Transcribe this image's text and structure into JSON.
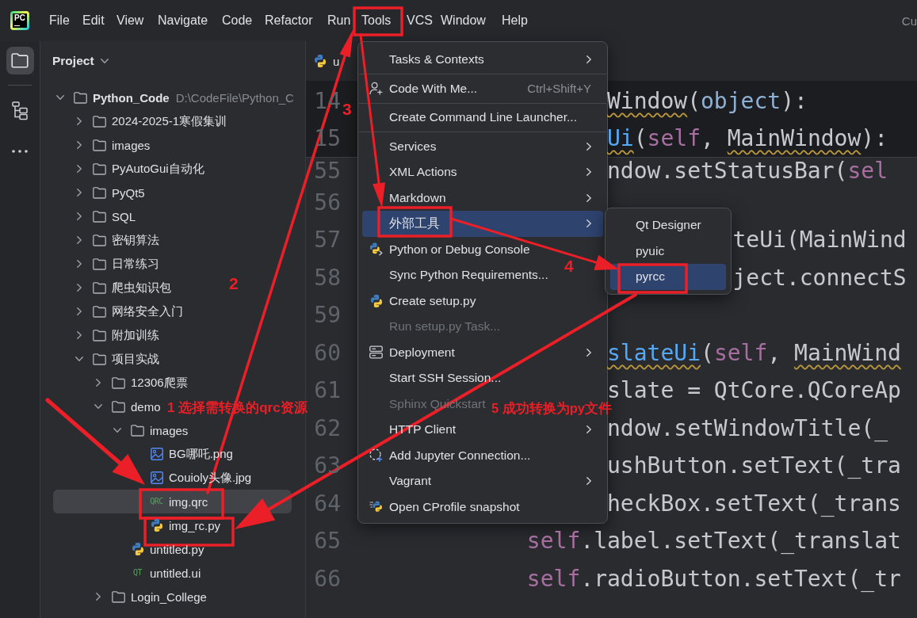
{
  "menu_bar": {
    "logo_text": "PC",
    "items": [
      "File",
      "Edit",
      "View",
      "Navigate",
      "Code",
      "Refactor",
      "Run",
      "Tools",
      "VCS",
      "Window",
      "Help"
    ],
    "right_text": "Cu"
  },
  "tool_strip": {
    "buttons": [
      {
        "selected": true
      },
      {
        "selected": false
      },
      {
        "selected": false
      }
    ]
  },
  "project_panel": {
    "title": "Project",
    "tree": [
      {
        "label": "Python_Code",
        "hint": "D:\\CodeFile\\Python_C",
        "kind": "folder",
        "expanded": true,
        "selected": false,
        "children": [
          {
            "label": "2024-2025-1寒假集训",
            "kind": "folder",
            "expanded": false,
            "selected": false
          },
          {
            "label": "images",
            "kind": "folder",
            "expanded": false,
            "selected": false
          },
          {
            "label": "PyAutoGui自动化",
            "kind": "folder",
            "expanded": false,
            "selected": false
          },
          {
            "label": "PyQt5",
            "kind": "folder",
            "expanded": false,
            "selected": false
          },
          {
            "label": "SQL",
            "kind": "folder",
            "expanded": false,
            "selected": false
          },
          {
            "label": "密钥算法",
            "kind": "folder",
            "expanded": false,
            "selected": false
          },
          {
            "label": "日常练习",
            "kind": "folder",
            "expanded": false,
            "selected": false
          },
          {
            "label": "爬虫知识包",
            "kind": "folder",
            "expanded": false,
            "selected": false
          },
          {
            "label": "网络安全入门",
            "kind": "folder",
            "expanded": false,
            "selected": false
          },
          {
            "label": "附加训练",
            "kind": "folder",
            "expanded": false,
            "selected": false
          },
          {
            "label": "项目实战",
            "kind": "folder",
            "expanded": true,
            "selected": false,
            "children": [
              {
                "label": "12306爬票",
                "kind": "folder",
                "expanded": false,
                "selected": false
              },
              {
                "label": "demo",
                "kind": "folder",
                "expanded": true,
                "selected": false,
                "children": [
                  {
                    "label": "images",
                    "kind": "folder",
                    "expanded": true,
                    "selected": false,
                    "children": [
                      {
                        "label": "BG哪吒.png",
                        "kind": "image",
                        "selected": false
                      },
                      {
                        "label": "Couioly头像.jpg",
                        "kind": "image",
                        "selected": false
                      },
                      {
                        "label": "img.qrc",
                        "kind": "qrc",
                        "badge": "QRC",
                        "selected": true
                      },
                      {
                        "label": "img_rc.py",
                        "kind": "python",
                        "selected": false
                      }
                    ]
                  },
                  {
                    "label": "untitled.py",
                    "kind": "python",
                    "selected": false
                  },
                  {
                    "label": "untitled.ui",
                    "kind": "ui",
                    "badge": "QT",
                    "selected": false
                  }
                ]
              },
              {
                "label": "Login_College",
                "kind": "folder",
                "expanded": false,
                "selected": false
              }
            ]
          }
        ]
      }
    ]
  },
  "editor": {
    "tab": {
      "label": "u"
    },
    "sticky_lines": [
      {
        "number": "14",
        "tokens": [
          {
            "text": "Window",
            "kind": "plain",
            "warning": true
          },
          {
            "text": "(",
            "kind": "plain",
            "warning": false
          },
          {
            "text": "object",
            "kind": "builtin",
            "warning": false
          },
          {
            "text": "):",
            "kind": "plain",
            "warning": false
          }
        ]
      },
      {
        "number": "15",
        "tokens": [
          {
            "text": "Ui",
            "kind": "function",
            "warning": true
          },
          {
            "text": "(",
            "kind": "plain",
            "warning": false
          },
          {
            "text": "self",
            "kind": "self",
            "warning": false
          },
          {
            "text": ", ",
            "kind": "plain",
            "warning": false
          },
          {
            "text": "MainWindow",
            "kind": "plain",
            "warning": true
          },
          {
            "text": "):",
            "kind": "plain",
            "warning": false
          }
        ]
      }
    ],
    "lines": [
      {
        "number": "55",
        "tokens": [
          {
            "text": "ndow.setStatusBar(",
            "kind": "plain",
            "warning": false
          },
          {
            "text": "sel",
            "kind": "self",
            "warning": false
          }
        ]
      },
      {
        "number": "56"
      },
      {
        "number": "57",
        "tokens": [
          {
            "text": "teUi(MainWind",
            "kind": "plain",
            "warning": false
          }
        ]
      },
      {
        "number": "58",
        "tokens": [
          {
            "text": "ject.connectS",
            "kind": "plain",
            "warning": false
          }
        ]
      },
      {
        "number": "59"
      },
      {
        "number": "60",
        "tokens": [
          {
            "text": "slateUi",
            "kind": "function",
            "warning": true
          },
          {
            "text": "(",
            "kind": "plain",
            "warning": false
          },
          {
            "text": "self",
            "kind": "self",
            "warning": false
          },
          {
            "text": ", ",
            "kind": "plain",
            "warning": false
          },
          {
            "text": "MainWind",
            "kind": "plain",
            "warning": true
          }
        ]
      },
      {
        "number": "61",
        "tokens": [
          {
            "text": "slate = QtCore.QCoreAp",
            "kind": "plain",
            "warning": false
          }
        ]
      },
      {
        "number": "62",
        "tokens": [
          {
            "text": "ndow.setWindowTitle(_",
            "kind": "plain",
            "warning": false
          }
        ]
      },
      {
        "number": "63",
        "tokens": [
          {
            "text": "ushButton.setText(_tra",
            "kind": "plain",
            "warning": false
          }
        ]
      },
      {
        "number": "64",
        "tokens": [
          {
            "text": "heckBox.setText(_trans",
            "kind": "plain",
            "warning": false
          }
        ]
      },
      {
        "number": "65",
        "tokens": [
          {
            "text": "self",
            "kind": "self",
            "warning": false
          },
          {
            "text": ".label.setText(_translat",
            "kind": "plain",
            "warning": false
          }
        ]
      },
      {
        "number": "66",
        "tokens": [
          {
            "text": "self",
            "kind": "self",
            "warning": false
          },
          {
            "text": ".radioButton.setText(_tr",
            "kind": "plain",
            "warning": false
          }
        ]
      }
    ]
  },
  "tools_menu": {
    "items": [
      {
        "label": "Tasks & Contexts",
        "kind": "submenu",
        "selected": false,
        "disabled": false
      },
      {
        "kind": "separator"
      },
      {
        "label": "Code With Me...",
        "shortcut": "Ctrl+Shift+Y",
        "kind": "action",
        "selected": false,
        "disabled": false
      },
      {
        "kind": "separator"
      },
      {
        "label": "Create Command Line Launcher...",
        "kind": "action",
        "selected": false,
        "disabled": false
      },
      {
        "kind": "separator"
      },
      {
        "label": "Services",
        "kind": "submenu",
        "selected": false,
        "disabled": false
      },
      {
        "label": "XML Actions",
        "kind": "submenu",
        "selected": false,
        "disabled": false
      },
      {
        "label": "Markdown",
        "kind": "submenu",
        "selected": false,
        "disabled": false
      },
      {
        "label": "外部工具",
        "kind": "submenu",
        "selected": true,
        "disabled": false
      },
      {
        "label": "Python or Debug Console",
        "kind": "action",
        "selected": false,
        "disabled": false
      },
      {
        "label": "Sync Python Requirements...",
        "kind": "action",
        "selected": false,
        "disabled": false
      },
      {
        "label": "Create setup.py",
        "kind": "action",
        "selected": false,
        "disabled": false
      },
      {
        "label": "Run setup.py Task...",
        "kind": "action",
        "selected": false,
        "disabled": true
      },
      {
        "label": "Deployment",
        "kind": "submenu",
        "selected": false,
        "disabled": false
      },
      {
        "label": "Start SSH Session...",
        "kind": "action",
        "selected": false,
        "disabled": false
      },
      {
        "label": "Sphinx Quickstart",
        "kind": "action",
        "selected": false,
        "disabled": true
      },
      {
        "label": "HTTP Client",
        "kind": "submenu",
        "selected": false,
        "disabled": false
      },
      {
        "label": "Add Jupyter Connection...",
        "kind": "action",
        "selected": false,
        "disabled": false
      },
      {
        "label": "Vagrant",
        "kind": "submenu",
        "selected": false,
        "disabled": false
      },
      {
        "label": "Open CProfile snapshot",
        "kind": "action",
        "selected": false,
        "disabled": false
      }
    ]
  },
  "external_tools_submenu": {
    "items": [
      {
        "label": "Qt Designer",
        "selected": false
      },
      {
        "label": "pyuic",
        "selected": false
      },
      {
        "label": "pyrcc",
        "selected": true
      }
    ]
  },
  "annotations": [
    {
      "text": "3"
    },
    {
      "text": "4"
    },
    {
      "text": "2"
    },
    {
      "text": "1 选择需转换的qrc资源"
    },
    {
      "text": "5 成功转换为py文件"
    }
  ]
}
